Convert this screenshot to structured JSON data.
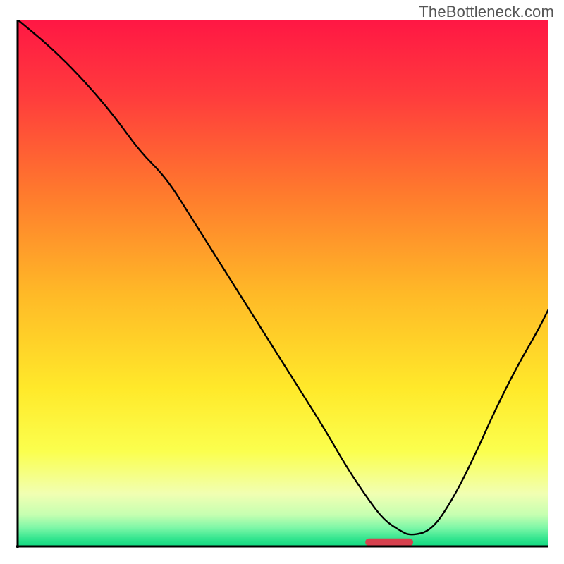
{
  "watermark": "TheBottleneck.com",
  "chart_data": {
    "type": "line",
    "title": "",
    "xlabel": "",
    "ylabel": "",
    "xlim": [
      0,
      100
    ],
    "ylim": [
      0,
      100
    ],
    "axes": {
      "left": true,
      "bottom": true,
      "right": false,
      "top": false,
      "ticks_visible": false,
      "grid": false
    },
    "background_gradient": {
      "type": "vertical",
      "stops": [
        {
          "pos": 0.0,
          "color": "#ff1744"
        },
        {
          "pos": 0.14,
          "color": "#ff3a3d"
        },
        {
          "pos": 0.33,
          "color": "#ff7a2d"
        },
        {
          "pos": 0.52,
          "color": "#ffb927"
        },
        {
          "pos": 0.7,
          "color": "#ffe92a"
        },
        {
          "pos": 0.82,
          "color": "#fbff4e"
        },
        {
          "pos": 0.9,
          "color": "#f1ffb2"
        },
        {
          "pos": 0.94,
          "color": "#c6ffb1"
        },
        {
          "pos": 0.965,
          "color": "#7cf7a7"
        },
        {
          "pos": 0.985,
          "color": "#34e58f"
        },
        {
          "pos": 1.0,
          "color": "#11d880"
        }
      ]
    },
    "series": [
      {
        "name": "bottleneck-curve",
        "color": "#000000",
        "width": 2.4,
        "x": [
          0,
          6,
          12,
          18,
          23,
          28,
          33,
          38,
          43,
          48,
          53,
          58,
          62,
          66,
          69,
          72,
          74,
          78,
          82,
          86,
          90,
          94,
          98,
          100
        ],
        "y": [
          100,
          95,
          89,
          82,
          75,
          70,
          62,
          54,
          46,
          38,
          30,
          22,
          15,
          9,
          5,
          3,
          2,
          3,
          9,
          17,
          26,
          34,
          41,
          45
        ]
      }
    ],
    "annotations": [
      {
        "name": "optimal-marker",
        "shape": "rounded-rect",
        "x_center": 70,
        "y": 0.8,
        "width": 9,
        "height": 1.4,
        "fill": "#d6414e"
      }
    ]
  }
}
